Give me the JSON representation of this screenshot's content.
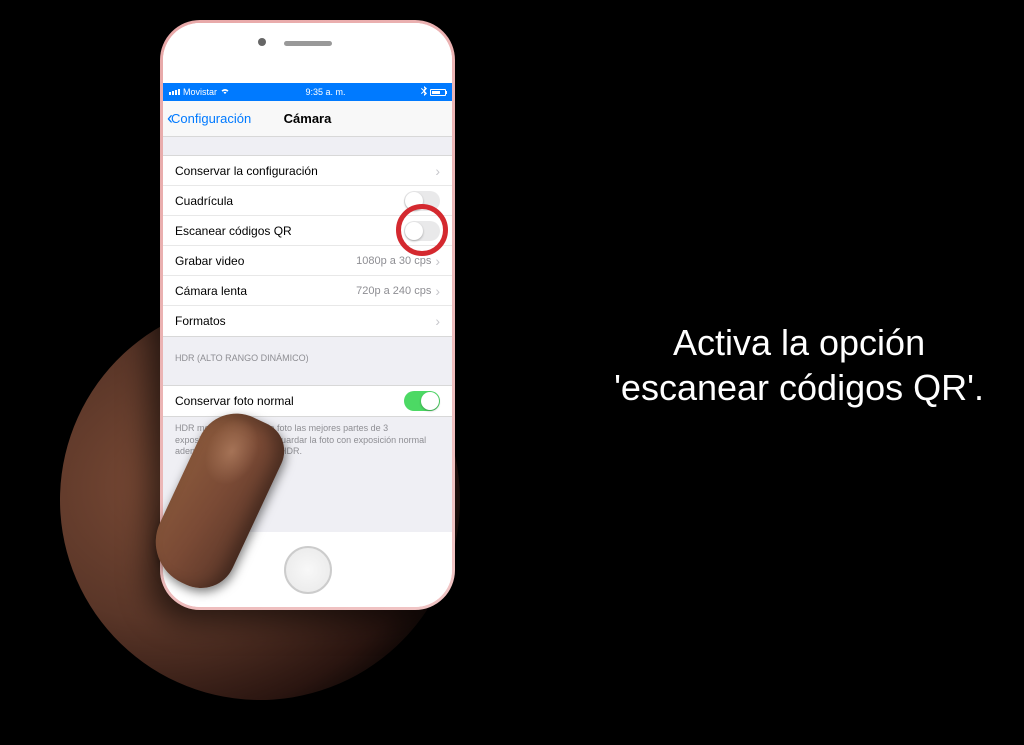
{
  "status_bar": {
    "carrier": "Movistar",
    "time": "9:35 a. m.",
    "bluetooth_icon": "bluetooth-icon"
  },
  "nav": {
    "back_label": "Configuración",
    "title": "Cámara"
  },
  "group1": {
    "items": [
      {
        "label": "Conservar la configuración",
        "type": "disclosure"
      },
      {
        "label": "Cuadrícula",
        "type": "toggle",
        "on": false
      },
      {
        "label": "Escanear códigos QR",
        "type": "toggle",
        "on": false
      },
      {
        "label": "Grabar video",
        "value": "1080p a 30 cps",
        "type": "disclosure"
      },
      {
        "label": "Cámara lenta",
        "value": "720p a 240 cps",
        "type": "disclosure"
      },
      {
        "label": "Formatos",
        "type": "disclosure"
      }
    ]
  },
  "group2": {
    "header": "HDR (ALTO RANGO DINÁMICO)",
    "items": [
      {
        "label": "Conservar foto normal",
        "type": "toggle",
        "on": true
      }
    ],
    "footer": "HDR mezcla en una sola foto las mejores partes de 3 exposiciones diferentes. Guardar la foto con exposición normal además de la versión con HDR."
  },
  "instruction": {
    "line1": "Activa la opción",
    "line2": "'escanear códigos QR'."
  }
}
